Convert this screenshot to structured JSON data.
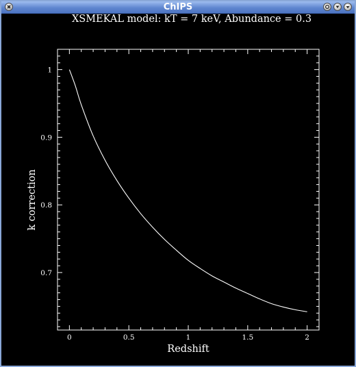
{
  "window": {
    "title": "ChIPS",
    "icons": [
      "close-icon",
      "maximize-icon",
      "dropdown-icon",
      "menu-icon"
    ]
  },
  "chart_data": {
    "type": "line",
    "title": "XSMEKAL model: kT = 7 keV, Abundance = 0.3",
    "xlabel": "Redshift",
    "ylabel": "k correction",
    "xlim": [
      -0.1,
      2.1
    ],
    "ylim": [
      0.615,
      1.03
    ],
    "xticks": [
      0,
      0.5,
      1,
      1.5,
      2
    ],
    "xtick_labels": [
      "0",
      "0.5",
      "1",
      "1.5",
      "2"
    ],
    "yticks": [
      0.7,
      0.8,
      0.9,
      1
    ],
    "ytick_labels": [
      "0.7",
      "0.8",
      "0.9",
      "1"
    ],
    "grid": false,
    "colors": {
      "background": "#000000",
      "foreground": "#ffffff",
      "line": "#ffffff"
    },
    "series": [
      {
        "x": [
          0,
          0.05,
          0.1,
          0.2,
          0.3,
          0.4,
          0.5,
          0.6,
          0.7,
          0.8,
          0.9,
          1.0,
          1.1,
          1.2,
          1.3,
          1.4,
          1.5,
          1.6,
          1.7,
          1.8,
          1.9,
          2.0
        ],
        "y": [
          1.0,
          0.976,
          0.948,
          0.902,
          0.866,
          0.836,
          0.81,
          0.787,
          0.767,
          0.749,
          0.733,
          0.718,
          0.706,
          0.695,
          0.686,
          0.677,
          0.669,
          0.661,
          0.654,
          0.649,
          0.645,
          0.642
        ]
      }
    ]
  }
}
